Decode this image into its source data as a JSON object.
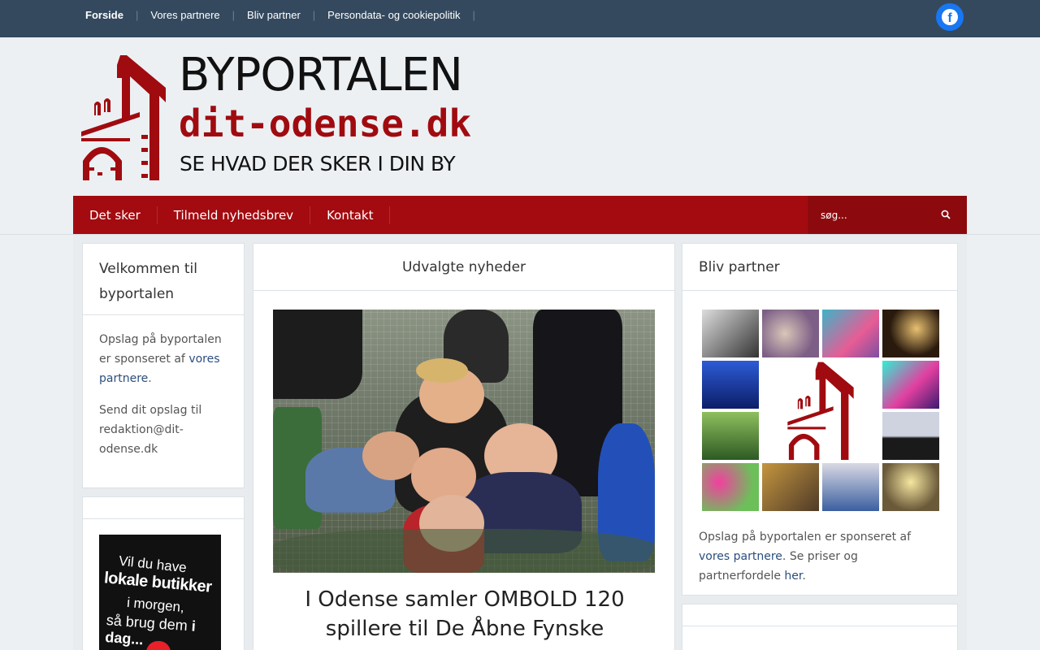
{
  "topnav": {
    "items": [
      {
        "label": "Forside",
        "active": true
      },
      {
        "label": "Vores partnere",
        "active": false
      },
      {
        "label": "Bliv partner",
        "active": false
      },
      {
        "label": "Persondata- og cookiepolitik",
        "active": false
      }
    ],
    "social_icon": "facebook-icon",
    "social_glyph": "f"
  },
  "logo": {
    "title": "BYPORTALEN",
    "domain": "dit-odense.dk",
    "tagline": "SE HVAD DER SKER I DIN BY"
  },
  "mainnav": {
    "items": [
      "Det sker",
      "Tilmeld nyhedsbrev",
      "Kontakt"
    ],
    "search_placeholder": "søg...",
    "search_icon": "search-icon"
  },
  "left_widget": {
    "title": "Velkommen til byportalen",
    "p1_text": "Opslag på byportalen er sponseret af",
    "p1_link": "vores partnere",
    "p1_end": ".",
    "p2": "Send dit opslag til redaktion@dit-odense.dk"
  },
  "left_promo": {
    "line1": "Vil du have",
    "line2": "lokale butikker",
    "line3": "i morgen,",
    "line4_a": "så brug dem",
    "line4_b": "i dag..."
  },
  "center": {
    "title": "Udvalgte nyheder",
    "article_title": "I Odense samler OMBOLD 120 spillere til De Åbne Fynske"
  },
  "right_widget": {
    "title": "Bliv partner",
    "text1": "Opslag på byportalen er sponseret af",
    "link1": "vores partnere",
    "text2": ". Se priser og partnerfordele",
    "link2": "her",
    "text3": "."
  },
  "colors": {
    "topbar": "#34495e",
    "brand_red": "#a30b10",
    "link": "#2b4e7e",
    "facebook": "#1877f2"
  }
}
